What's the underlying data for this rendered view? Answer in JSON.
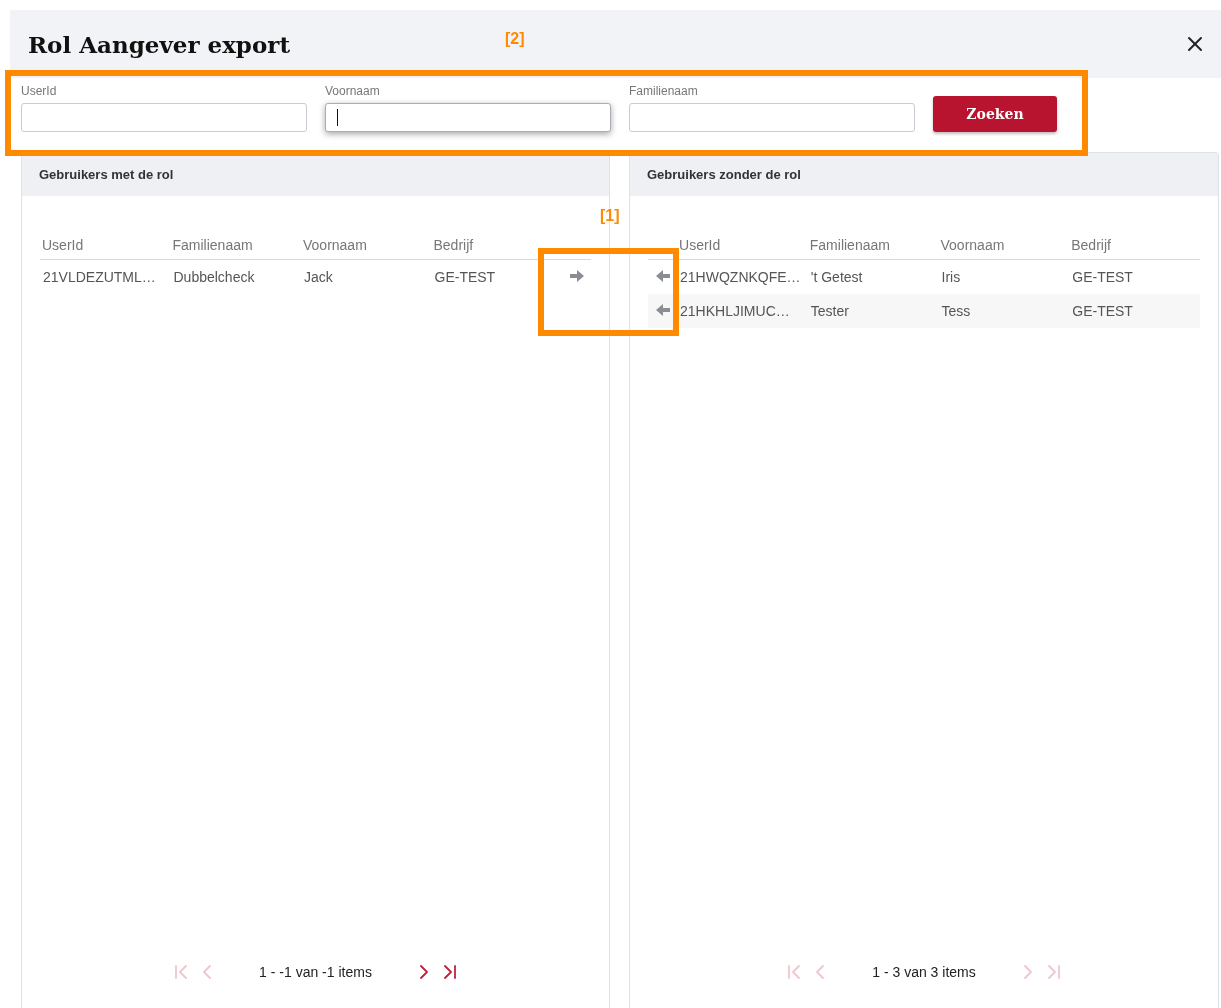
{
  "dialog": {
    "title": "Rol Aangever export"
  },
  "search": {
    "fields": [
      {
        "label": "UserId",
        "focused": false
      },
      {
        "label": "Voornaam",
        "focused": true
      },
      {
        "label": "Familienaam",
        "focused": false
      }
    ],
    "button": "Zoeken"
  },
  "panels": [
    {
      "kind": "with",
      "title": "Gebruikers met de rol",
      "columns": [
        "UserId",
        "Familienaam",
        "Voornaam",
        "Bedrijf"
      ],
      "rows": [
        {
          "cells": [
            "21VLDEZUTML…",
            "Dubbelcheck",
            "Jack",
            "GE-TEST"
          ]
        }
      ],
      "pager": {
        "summary": "1 - -1 van -1 items",
        "buttons": [
          {
            "kind": "first",
            "disabled": true
          },
          {
            "kind": "prev",
            "disabled": true
          },
          {
            "kind": "next",
            "disabled": false
          },
          {
            "kind": "last",
            "disabled": false
          }
        ]
      }
    },
    {
      "kind": "without",
      "title": "Gebruikers zonder de rol",
      "columns": [
        "UserId",
        "Familienaam",
        "Voornaam",
        "Bedrijf"
      ],
      "rows": [
        {
          "cells": [
            "21HWQZNKQFE…",
            "'t Getest",
            "Iris",
            "GE-TEST"
          ]
        },
        {
          "cells": [
            "21HKHLJIMUC…",
            "Tester",
            "Tess",
            "GE-TEST"
          ]
        }
      ],
      "pager": {
        "summary": "1 - 3 van 3 items",
        "buttons": [
          {
            "kind": "first",
            "disabled": true
          },
          {
            "kind": "prev",
            "disabled": true
          },
          {
            "kind": "next",
            "disabled": true
          },
          {
            "kind": "last",
            "disabled": true
          }
        ]
      }
    }
  ],
  "annotations": [
    {
      "label": "[2]"
    },
    {
      "label": "[1]"
    }
  ]
}
